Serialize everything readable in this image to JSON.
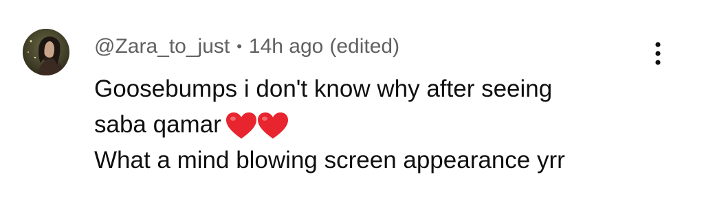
{
  "comment": {
    "handle": "@Zara_to_just",
    "separator": "•",
    "time": "14h ago",
    "edited": "(edited)",
    "lines": [
      "Goosebumps i don't know why after seeing",
      "saba qamar",
      "What a mind blowing screen appearance yrr"
    ],
    "emoji": "red-heart-icon x2"
  },
  "icons": {
    "avatar": "profile-photo",
    "more": "vertical-ellipsis-icon"
  },
  "colors": {
    "text": "#0f0f0f",
    "meta": "#606060",
    "heart": "#e8242f",
    "background": "#ffffff"
  }
}
